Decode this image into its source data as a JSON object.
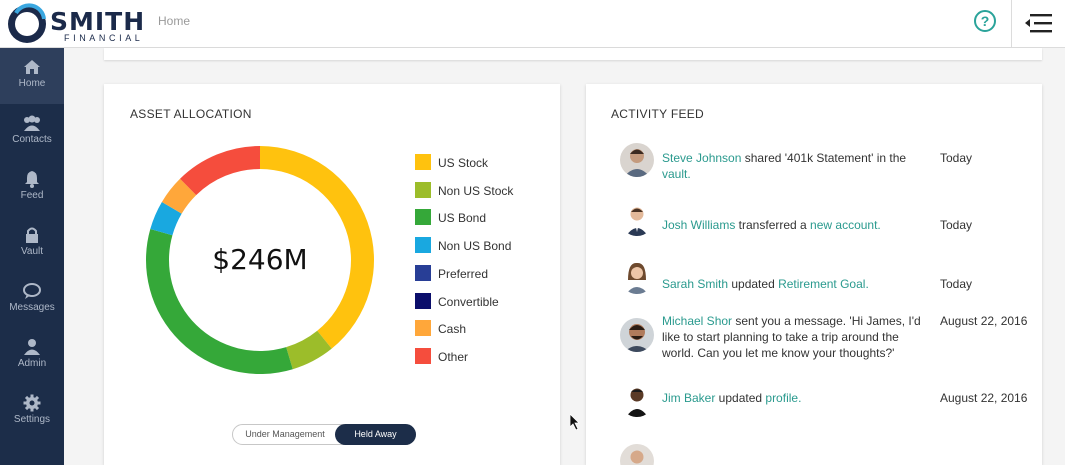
{
  "brand": {
    "name": "SMITH",
    "sub": "FINANCIAL"
  },
  "header": {
    "breadcrumb": "Home",
    "help_symbol": "?"
  },
  "sidebar": {
    "items": [
      {
        "label": "Home",
        "icon": "home-icon",
        "active": true
      },
      {
        "label": "Contacts",
        "icon": "contacts-icon"
      },
      {
        "label": "Feed",
        "icon": "bell-icon"
      },
      {
        "label": "Vault",
        "icon": "lock-icon"
      },
      {
        "label": "Messages",
        "icon": "chat-icon"
      },
      {
        "label": "Admin",
        "icon": "user-icon"
      },
      {
        "label": "Settings",
        "icon": "gear-icon"
      }
    ]
  },
  "asset_allocation": {
    "title": "ASSET ALLOCATION",
    "total": "$246M",
    "toggle": {
      "option1": "Under Management",
      "option2": "Held Away",
      "selected": "Held Away"
    }
  },
  "chart_data": {
    "type": "pie",
    "donut": true,
    "categories": [
      "US Stock",
      "Non US Stock",
      "US Bond",
      "Non US Bond",
      "Preferred",
      "Convertible",
      "Cash",
      "Other"
    ],
    "values": [
      38,
      6,
      33,
      4,
      0,
      0,
      4,
      12
    ],
    "colors": [
      "#ffc20e",
      "#9cbd2a",
      "#35a839",
      "#19a8e0",
      "#283e96",
      "#0b0e6b",
      "#ffa73a",
      "#f54d3d"
    ],
    "legend": "right"
  },
  "activity_feed": {
    "title": "ACTIVITY FEED",
    "items": [
      {
        "name": "Steve Johnson",
        "text": " shared '401k Statement' in the ",
        "link": "vault.",
        "date": "Today"
      },
      {
        "name": "Josh Williams",
        "text": " transferred a ",
        "link": "new account.",
        "date": "Today"
      },
      {
        "name": "Sarah Smith",
        "text": " updated ",
        "link": "Retirement Goal.",
        "date": "Today"
      },
      {
        "name": "Michael Shor",
        "text": " sent you a message. 'Hi James, I'd like to start planning to take a trip around the world. Can you let me know your thoughts?'",
        "link": "",
        "date": "August 22, 2016"
      },
      {
        "name": "Jim Baker",
        "text": " updated ",
        "link": "profile.",
        "date": "August 22, 2016"
      }
    ]
  }
}
